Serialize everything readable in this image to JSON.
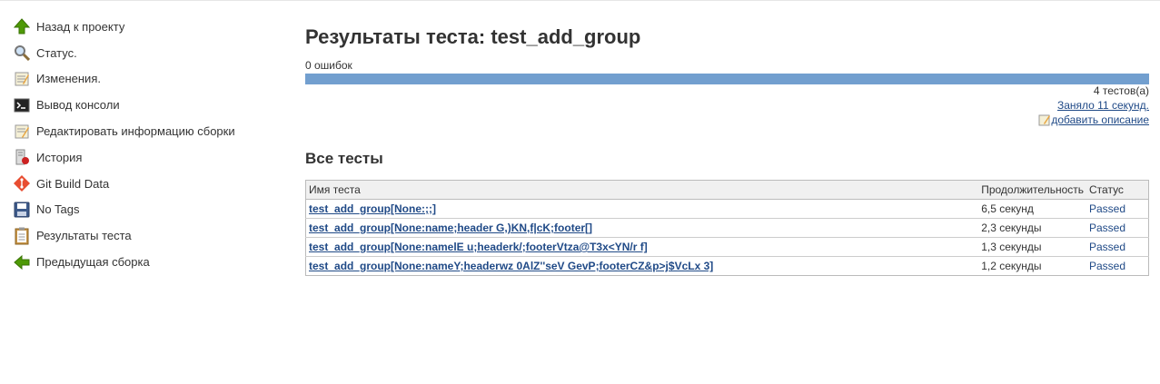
{
  "sidebar": {
    "items": [
      {
        "label": "Назад к проекту",
        "icon": "up-arrow-icon"
      },
      {
        "label": "Статус.",
        "icon": "search-icon"
      },
      {
        "label": "Изменения.",
        "icon": "notepad-icon"
      },
      {
        "label": "Вывод консоли",
        "icon": "terminal-icon"
      },
      {
        "label": "Редактировать информацию сборки",
        "icon": "notepad-edit-icon"
      },
      {
        "label": "История",
        "icon": "history-icon"
      },
      {
        "label": "Git Build Data",
        "icon": "git-icon"
      },
      {
        "label": "No Tags",
        "icon": "floppy-icon"
      },
      {
        "label": "Результаты теста",
        "icon": "clipboard-icon"
      },
      {
        "label": "Предыдущая сборка",
        "icon": "back-arrow-icon"
      }
    ]
  },
  "main": {
    "title": "Результаты теста: test_add_group",
    "fail_count": "0 ошибок",
    "progress_passed": 1.0,
    "tests_count": "4 тестов(а)",
    "duration_link": "Заняло 11 секунд.",
    "add_description": "добавить описание",
    "all_tests_heading": "Все тесты",
    "table": {
      "headers": [
        "Имя теста",
        "Продолжительность",
        "Статус"
      ],
      "rows": [
        {
          "name": "test_add_group[None:;;]",
          "duration": "6,5 секунд",
          "status": "Passed"
        },
        {
          "name": "test_add_group[None:name;header G,)KN,f|cK;footer[]",
          "duration": "2,3 секунды",
          "status": "Passed"
        },
        {
          "name": "test_add_group[None:namelE   u;headerk/;footerVtza@T3x<YN/r f]",
          "duration": "1,3 секунды",
          "status": "Passed"
        },
        {
          "name": "test_add_group[None:nameY;headerwz 0AlZ''seV GevP;footerCZ&p>j$VcLx 3]",
          "duration": "1,2 секунды",
          "status": "Passed"
        }
      ]
    }
  },
  "colors": {
    "bar": "#729fcf",
    "link": "#204a87"
  }
}
